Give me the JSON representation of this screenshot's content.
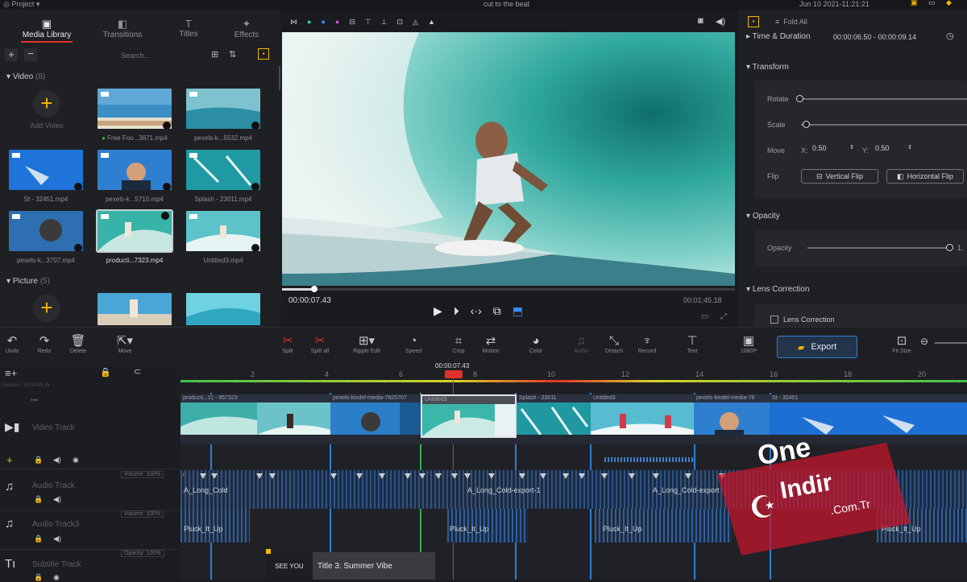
{
  "window": {
    "menu_label": "Project",
    "title": "cut to the beat",
    "datetime": "Jun 10 2021-11:21:21"
  },
  "tabs": [
    {
      "label": "Media Library"
    },
    {
      "label": "Transitions"
    },
    {
      "label": "Titles"
    },
    {
      "label": "Effects"
    }
  ],
  "media": {
    "search_placeholder": "Search...",
    "video_group": "Video",
    "video_count": "(8)",
    "add_video": "Add Video",
    "picture_group": "Picture",
    "picture_count": "(5)",
    "items": [
      {
        "name": "Free Foo...3871.mp4"
      },
      {
        "name": "pexels-k...5532.mp4"
      },
      {
        "name": "St - 32451.mp4"
      },
      {
        "name": "pexels-k...5710.mp4"
      },
      {
        "name": "Splash - 23011.mp4"
      },
      {
        "name": "pexels-k...3707.mp4"
      },
      {
        "name": "producti...7323.mp4"
      },
      {
        "name": "Untitled3.mp4"
      }
    ]
  },
  "preview": {
    "current_time": "00:00:07.43",
    "total_time": "00:01:45.18",
    "playback_progress": 0.07
  },
  "properties": {
    "fold_all": "Fold All",
    "time_duration_label": "Time & Duration",
    "time_duration_value": "00:00:06.50 - 00:00:09.14",
    "transform": "Transform",
    "rotate": "Rotate",
    "scale": "Scale",
    "move": "Move",
    "move_x_label": "X:",
    "move_x": "0.50",
    "move_y_label": "Y:",
    "move_y": "0.50",
    "flip": "Flip",
    "vertical_flip": "Vertical Flip",
    "horizontal_flip": "Horizontal Flip",
    "opacity_section": "Opacity",
    "opacity_label": "Opacity",
    "opacity_value": "1.",
    "lens_section": "Lens Correction",
    "lens_checkbox": "Lens Correction"
  },
  "toolbar": {
    "undo": "Undo",
    "redo": "Redo",
    "delete": "Delete",
    "move": "Move",
    "split": "Split",
    "split_all": "Split all",
    "ripple_edit": "Ripple Edit",
    "speed": "Speed",
    "crop": "Crop",
    "motion": "Motion",
    "color": "Color",
    "audio": "Audio",
    "detach": "Detach",
    "record": "Record",
    "text": "Text",
    "resolution": "1080P",
    "export": "Export",
    "fit_size": "Fit Size"
  },
  "timeline": {
    "playhead_time": "00:00:07.43",
    "duration_label": "Duration : 00:00:45.15",
    "ruler": [
      "2",
      "4",
      "6",
      "8",
      "10",
      "12",
      "14",
      "16",
      "18",
      "20"
    ],
    "video_track": "Video Track",
    "audio_track": "Audio Track",
    "audio_track2": "Audio Track3",
    "subtitle_track": "Subtitle Track",
    "volume1": "Volume: 100%",
    "volume2": "Volume: 100%",
    "opacity_badge": "Opacity: 100%",
    "clips": [
      {
        "name": "producti...11 - 957323"
      },
      {
        "name": "pexels-kindel-media-7825707"
      },
      {
        "name": "Untitled3"
      },
      {
        "name": "Splash - 23011"
      },
      {
        "name": "Untitled3"
      },
      {
        "name": "pexels-kindel-media-76"
      },
      {
        "name": "St - 32451"
      }
    ],
    "audio_clips": [
      {
        "name": "A_Long_Cold"
      },
      {
        "name": "A_Long_Cold-export-1"
      },
      {
        "name": "A_Long_Cold-export"
      }
    ],
    "audio2_clips": [
      {
        "name": "Pluck_It_Up"
      },
      {
        "name": "Pluck_It_Up"
      },
      {
        "name": "Pluck_It_Up"
      },
      {
        "name": "Pluck_It_Up"
      }
    ],
    "subtitle_preview": "SEE YOU",
    "subtitle_title": "Title 3: Summer Vibe"
  },
  "watermark": {
    "line1": "One",
    "line2": "Indir",
    "line3": ".Com.Tr"
  },
  "colors": {
    "accent": "#f5b800",
    "marker": "#2f7fd6",
    "playhead": "#e0322b",
    "selection": "#2fb34a"
  }
}
